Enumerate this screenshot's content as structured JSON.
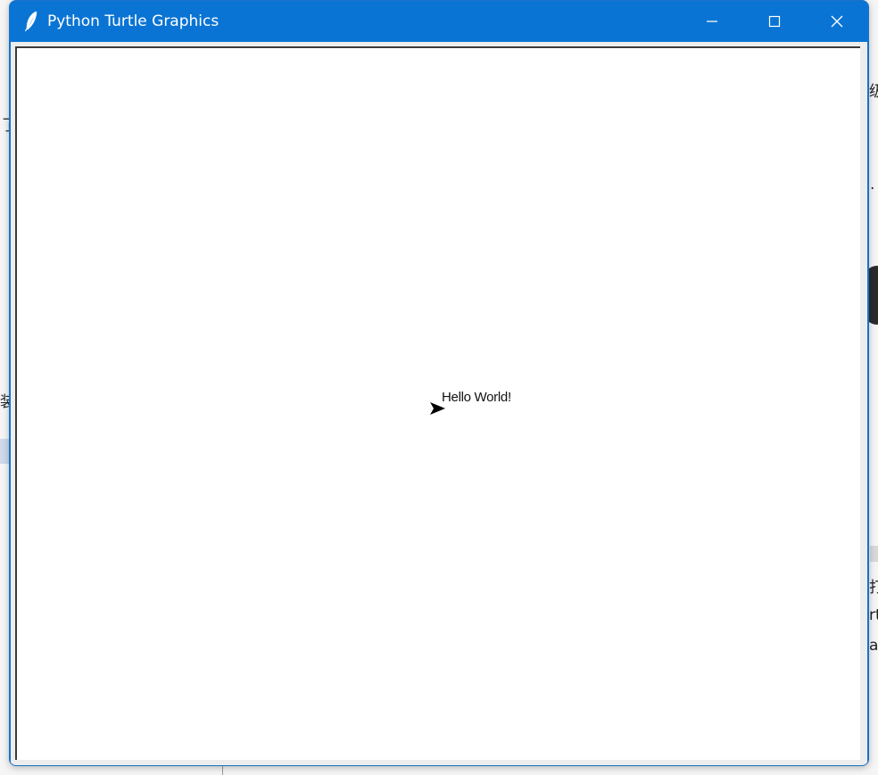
{
  "window": {
    "title": "Python Turtle Graphics",
    "icon": "feather-icon",
    "controls": {
      "minimize": "minimize-icon",
      "maximize": "maximize-icon",
      "close": "close-icon"
    }
  },
  "canvas": {
    "text": "Hello World!",
    "turtle_shape": "arrow-icon",
    "background": "#ffffff"
  },
  "background_fragments": {
    "left_1": "了",
    "left_2": "装",
    "right_1": "级",
    "right_2": "·",
    "right_3": "打",
    "right_4": "rt",
    "right_5": "a"
  },
  "colors": {
    "titlebar": "#0a74d4",
    "title_text": "#ffffff",
    "turtle": "#000000"
  }
}
